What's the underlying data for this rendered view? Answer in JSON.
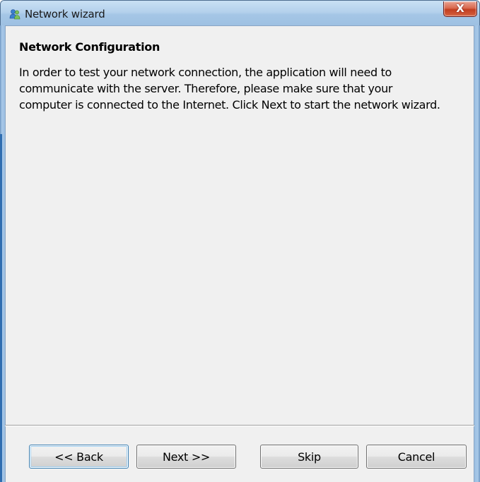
{
  "window": {
    "title": "Network wizard",
    "app_icon": "users-icon",
    "close_glyph": "X",
    "close_icon": "close-icon"
  },
  "content": {
    "heading": "Network Configuration",
    "body_lines": [
      "In order to test your network connection, the application will need to",
      "communicate with the server.  Therefore, please make sure that your",
      "computer is connected to the Internet.  Click Next to start the network wizard."
    ]
  },
  "buttons": {
    "back": "<< Back",
    "next": "Next >>",
    "skip": "Skip",
    "cancel": "Cancel"
  },
  "colors": {
    "titlebar": "#b4d1ec",
    "client_background": "#f0f0f0",
    "close_button": "#c23e20",
    "focus_border": "#3c7fb1"
  }
}
